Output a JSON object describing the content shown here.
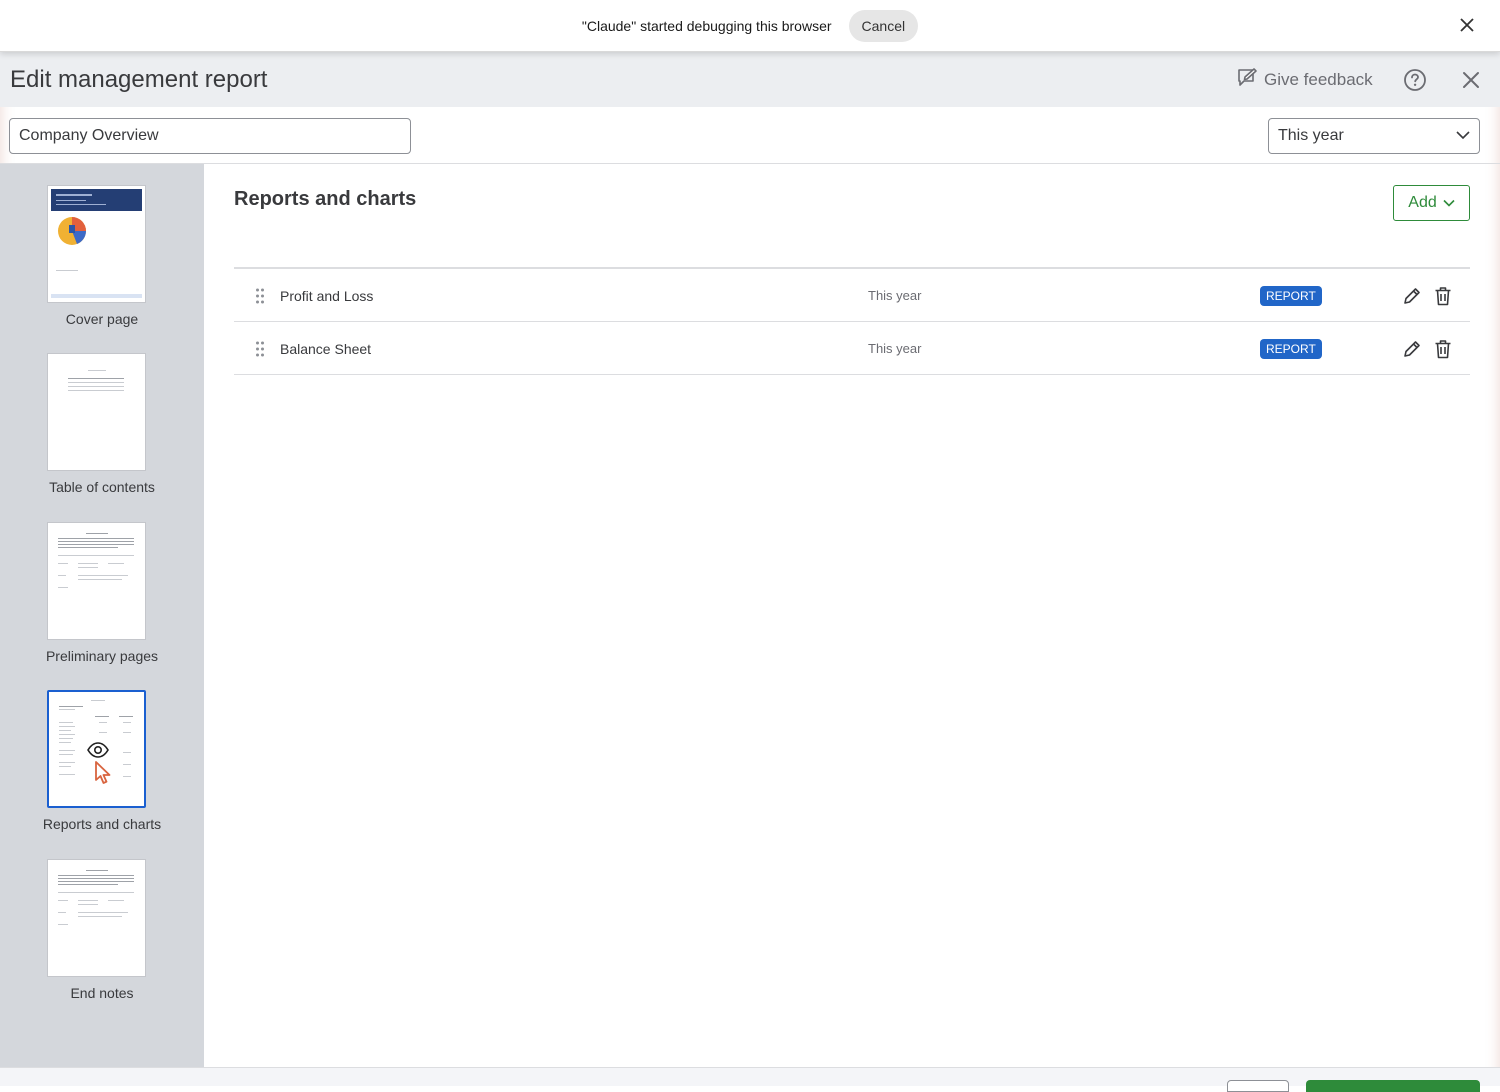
{
  "debug_bar": {
    "message": "\"Claude\" started debugging this browser",
    "cancel_label": "Cancel",
    "close_icon": "close-icon"
  },
  "header": {
    "title": "Edit management report",
    "feedback_label": "Give feedback",
    "feedback_icon": "feedback-icon",
    "help_icon": "help-icon",
    "close_icon": "close-icon"
  },
  "controls": {
    "report_name": "Company Overview",
    "period": "This year"
  },
  "sidebar": {
    "items": [
      {
        "label": "Cover page",
        "selected": false
      },
      {
        "label": "Table of contents",
        "selected": false
      },
      {
        "label": "Preliminary pages",
        "selected": false
      },
      {
        "label": "Reports and charts",
        "selected": true
      },
      {
        "label": "End notes",
        "selected": false
      }
    ]
  },
  "main": {
    "title": "Reports and charts",
    "add_label": "Add",
    "rows": [
      {
        "name": "Profit and Loss",
        "period": "This year",
        "badge": "REPORT"
      },
      {
        "name": "Balance Sheet",
        "period": "This year",
        "badge": "REPORT"
      }
    ]
  },
  "colors": {
    "accent_green": "#2e8b3a",
    "badge_blue": "#2166c8",
    "selected_border": "#1a5fd0",
    "sidebar_bg": "#d4d7dc",
    "header_bg": "#eceef1"
  }
}
